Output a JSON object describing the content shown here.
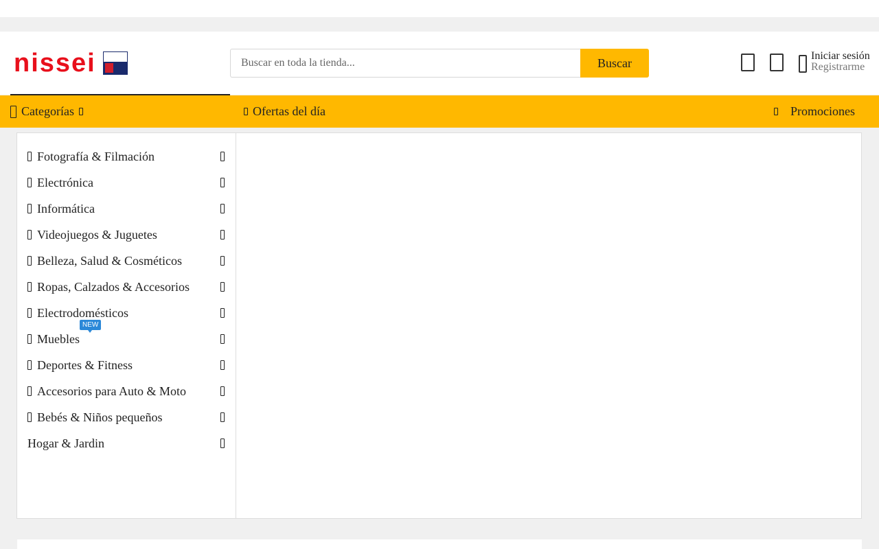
{
  "header": {
    "logo_text": "nissei",
    "search_placeholder": "Buscar en toda la tienda...",
    "search_button": "Buscar",
    "login_label": "Iniciar sesión",
    "register_label": "Registrarme",
    "icons": [
      "logo-badge",
      "heart-icon",
      "cart-icon",
      "user-icon"
    ]
  },
  "navbar": {
    "categories_label": "Categorías",
    "offers_label": "Ofertas del día",
    "promotions_label": "Promociones"
  },
  "sidebar": {
    "items": [
      {
        "label": "Fotografía & Filmación"
      },
      {
        "label": "Electrónica"
      },
      {
        "label": "Informática"
      },
      {
        "label": "Videojuegos & Juguetes"
      },
      {
        "label": "Belleza, Salud & Cosméticos"
      },
      {
        "label": "Ropas, Calzados & Accesorios"
      },
      {
        "label": "Electrodomésticos"
      },
      {
        "label": "Muebles",
        "badge": "NEW"
      },
      {
        "label": "Deportes & Fitness"
      },
      {
        "label": "Accesorios para Auto & Moto"
      },
      {
        "label": "Bebés & Niños pequeños"
      },
      {
        "label": "Hogar & Jardin"
      }
    ]
  },
  "colors": {
    "brand_red": "#e8101c",
    "accent_yellow": "#ffb800",
    "badge_blue": "#2b88d8",
    "page_bg": "#f0f0f0"
  }
}
